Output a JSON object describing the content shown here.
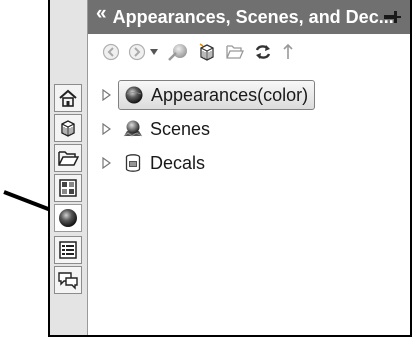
{
  "panel": {
    "title": "Appearances, Scenes, and Dec...",
    "collapse_glyph": "«"
  },
  "toolbar": {
    "items": [
      "back-icon",
      "forward-icon",
      "dropdown-icon",
      "appearance-color-icon",
      "3d-object-icon",
      "folder-icon",
      "refresh-icon",
      "up-arrow-icon"
    ]
  },
  "tree": {
    "items": [
      {
        "label": "Appearances(color)",
        "icon": "appearance-sphere-icon",
        "selected": true
      },
      {
        "label": "Scenes",
        "icon": "scene-icon",
        "selected": false
      },
      {
        "label": "Decals",
        "icon": "decal-icon",
        "selected": false
      }
    ]
  },
  "sidebar": {
    "tabs": [
      "home-icon",
      "3d-part-icon",
      "folder-open-icon",
      "view-palette-icon",
      "appearances-tab-icon",
      "properties-icon",
      "forum-icon"
    ],
    "active": "appearances-tab-icon"
  }
}
